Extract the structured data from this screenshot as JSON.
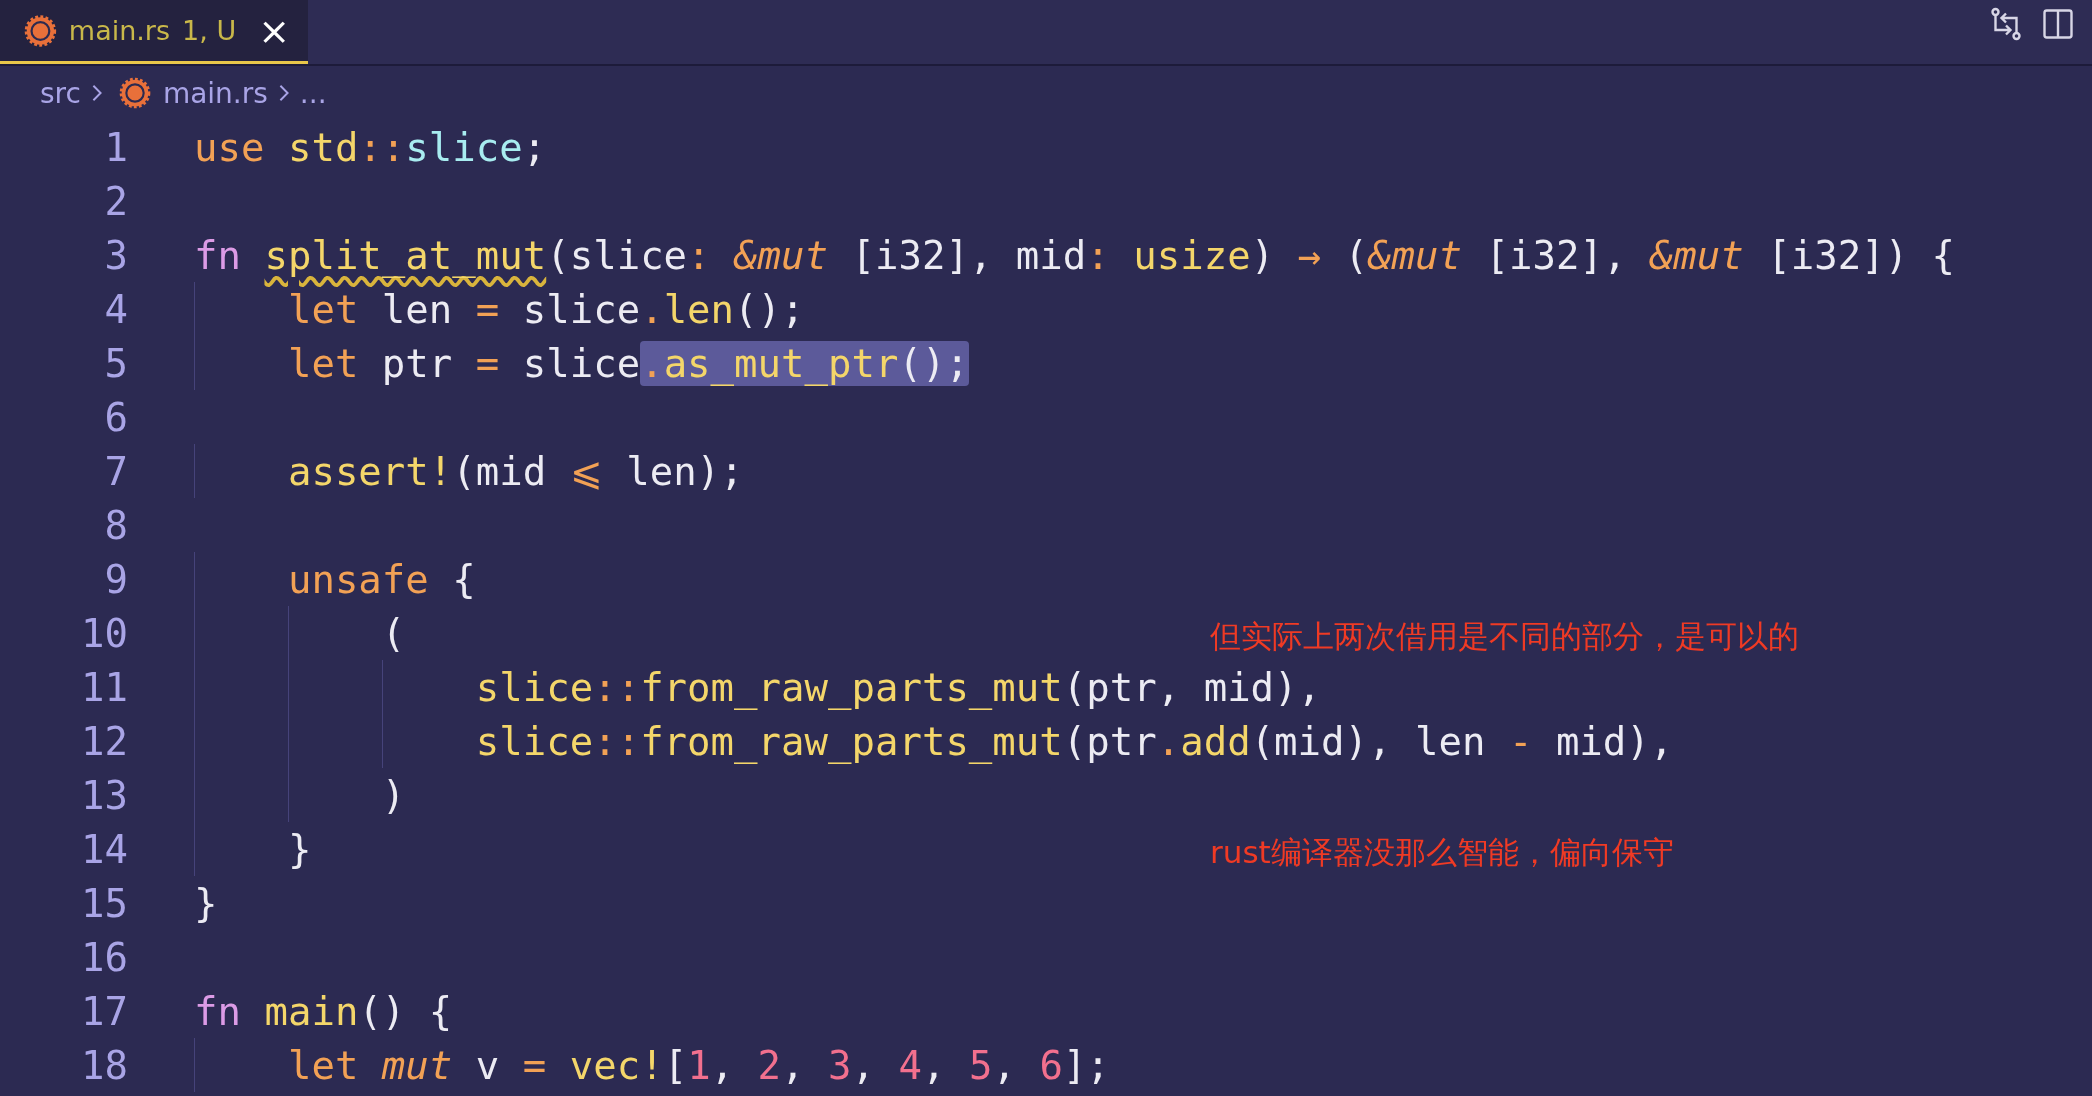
{
  "tab": {
    "file": "main.rs",
    "status": "1, U",
    "close": "×",
    "selected": true
  },
  "breadcrumb": {
    "folder": "src",
    "file": "main.rs",
    "more": "..."
  },
  "lines": [
    {
      "number": "1",
      "tokens": [
        {
          "kind": "keyword",
          "text": "use "
        },
        {
          "kind": "function",
          "text": "std"
        },
        {
          "kind": "operator",
          "text": "::"
        },
        {
          "kind": "module",
          "text": "slice"
        },
        {
          "kind": "plain",
          "text": ";"
        }
      ]
    },
    {
      "number": "2"
    },
    {
      "number": "3",
      "tokens": [
        {
          "kind": "fn_keyword",
          "text": "fn "
        },
        {
          "kind": "warning",
          "text": "split_at_mut"
        },
        {
          "kind": "plain",
          "text": "(slice"
        },
        {
          "kind": "operator",
          "text": ": "
        },
        {
          "kind": "modifier",
          "text": "&mut"
        },
        {
          "kind": "plain",
          "text": " [i32], mid"
        },
        {
          "kind": "operator",
          "text": ": "
        },
        {
          "kind": "function",
          "text": "usize"
        },
        {
          "kind": "plain",
          "text": ") "
        },
        {
          "kind": "operator",
          "text": "→"
        },
        {
          "kind": "plain",
          "text": " ("
        },
        {
          "kind": "modifier",
          "text": "&mut"
        },
        {
          "kind": "plain",
          "text": " [i32], "
        },
        {
          "kind": "modifier",
          "text": "&mut"
        },
        {
          "kind": "plain",
          "text": " [i32]) {"
        }
      ]
    },
    {
      "number": "4",
      "tokens": [
        {
          "kind": "keyword",
          "text": "    let"
        },
        {
          "kind": "plain",
          "text": " len "
        },
        {
          "kind": "operator",
          "text": "="
        },
        {
          "kind": "plain",
          "text": " slice"
        },
        {
          "kind": "operator",
          "text": "."
        },
        {
          "kind": "function",
          "text": "len"
        },
        {
          "kind": "plain",
          "text": "();"
        }
      ]
    },
    {
      "number": "5",
      "tokens": [
        {
          "kind": "keyword",
          "text": "    let"
        },
        {
          "kind": "plain",
          "text": " ptr "
        },
        {
          "kind": "operator",
          "text": "="
        },
        {
          "kind": "plain",
          "text": " slice"
        }
      ],
      "selection": [
        {
          "kind": "operator",
          "text": "."
        },
        {
          "kind": "function",
          "text": "as_mut_ptr"
        },
        {
          "kind": "plain",
          "text": "();"
        }
      ]
    },
    {
      "number": "6"
    },
    {
      "number": "7",
      "tokens": [
        {
          "kind": "function",
          "text": "    assert!"
        },
        {
          "kind": "plain",
          "text": "(mid "
        },
        {
          "kind": "operator",
          "text": "⩽"
        },
        {
          "kind": "plain",
          "text": " len);"
        }
      ]
    },
    {
      "number": "8"
    },
    {
      "number": "9",
      "tokens": [
        {
          "kind": "keyword",
          "text": "    unsafe"
        },
        {
          "kind": "plain",
          "text": " {"
        }
      ]
    },
    {
      "number": "10",
      "tokens": [
        {
          "kind": "plain",
          "text": "        ("
        }
      ],
      "note": "但实际上两次借用是不同的部分，是可以的"
    },
    {
      "number": "11",
      "tokens": [
        {
          "kind": "function",
          "text": "            slice"
        },
        {
          "kind": "operator",
          "text": "::"
        },
        {
          "kind": "function",
          "text": "from_raw_parts_mut"
        },
        {
          "kind": "plain",
          "text": "(ptr, mid),"
        }
      ]
    },
    {
      "number": "12",
      "tokens": [
        {
          "kind": "function",
          "text": "            slice"
        },
        {
          "kind": "operator",
          "text": "::"
        },
        {
          "kind": "function",
          "text": "from_raw_parts_mut"
        },
        {
          "kind": "plain",
          "text": "(ptr"
        },
        {
          "kind": "operator",
          "text": "."
        },
        {
          "kind": "function",
          "text": "add"
        },
        {
          "kind": "plain",
          "text": "(mid), len "
        },
        {
          "kind": "operator",
          "text": "-"
        },
        {
          "kind": "plain",
          "text": " mid),"
        }
      ]
    },
    {
      "number": "13",
      "tokens": [
        {
          "kind": "plain",
          "text": "        )"
        }
      ]
    },
    {
      "number": "14",
      "tokens": [
        {
          "kind": "plain",
          "text": "    }"
        }
      ],
      "note": "rust编译器没那么智能，偏向保守"
    },
    {
      "number": "15",
      "tokens": [
        {
          "kind": "plain",
          "text": "}"
        }
      ]
    },
    {
      "number": "16"
    },
    {
      "number": "17",
      "tokens": [
        {
          "kind": "fn_keyword",
          "text": "fn "
        },
        {
          "kind": "function",
          "text": "main"
        },
        {
          "kind": "plain",
          "text": "() {"
        }
      ]
    },
    {
      "number": "18",
      "tokens": [
        {
          "kind": "keyword",
          "text": "    let "
        },
        {
          "kind": "modifier_plain",
          "text": "mut"
        },
        {
          "kind": "plain",
          "text": " v "
        },
        {
          "kind": "operator",
          "text": "= "
        },
        {
          "kind": "function",
          "text": "vec!"
        },
        {
          "kind": "plain",
          "text": "["
        },
        {
          "kind": "number",
          "text": "1"
        },
        {
          "kind": "plain",
          "text": ", "
        },
        {
          "kind": "number",
          "text": "2"
        },
        {
          "kind": "plain",
          "text": ", "
        },
        {
          "kind": "number",
          "text": "3"
        },
        {
          "kind": "plain",
          "text": ", "
        },
        {
          "kind": "number",
          "text": "4"
        },
        {
          "kind": "plain",
          "text": ", "
        },
        {
          "kind": "number",
          "text": "5"
        },
        {
          "kind": "plain",
          "text": ", "
        },
        {
          "kind": "number",
          "text": "6"
        },
        {
          "kind": "plain",
          "text": "];"
        }
      ]
    }
  ]
}
